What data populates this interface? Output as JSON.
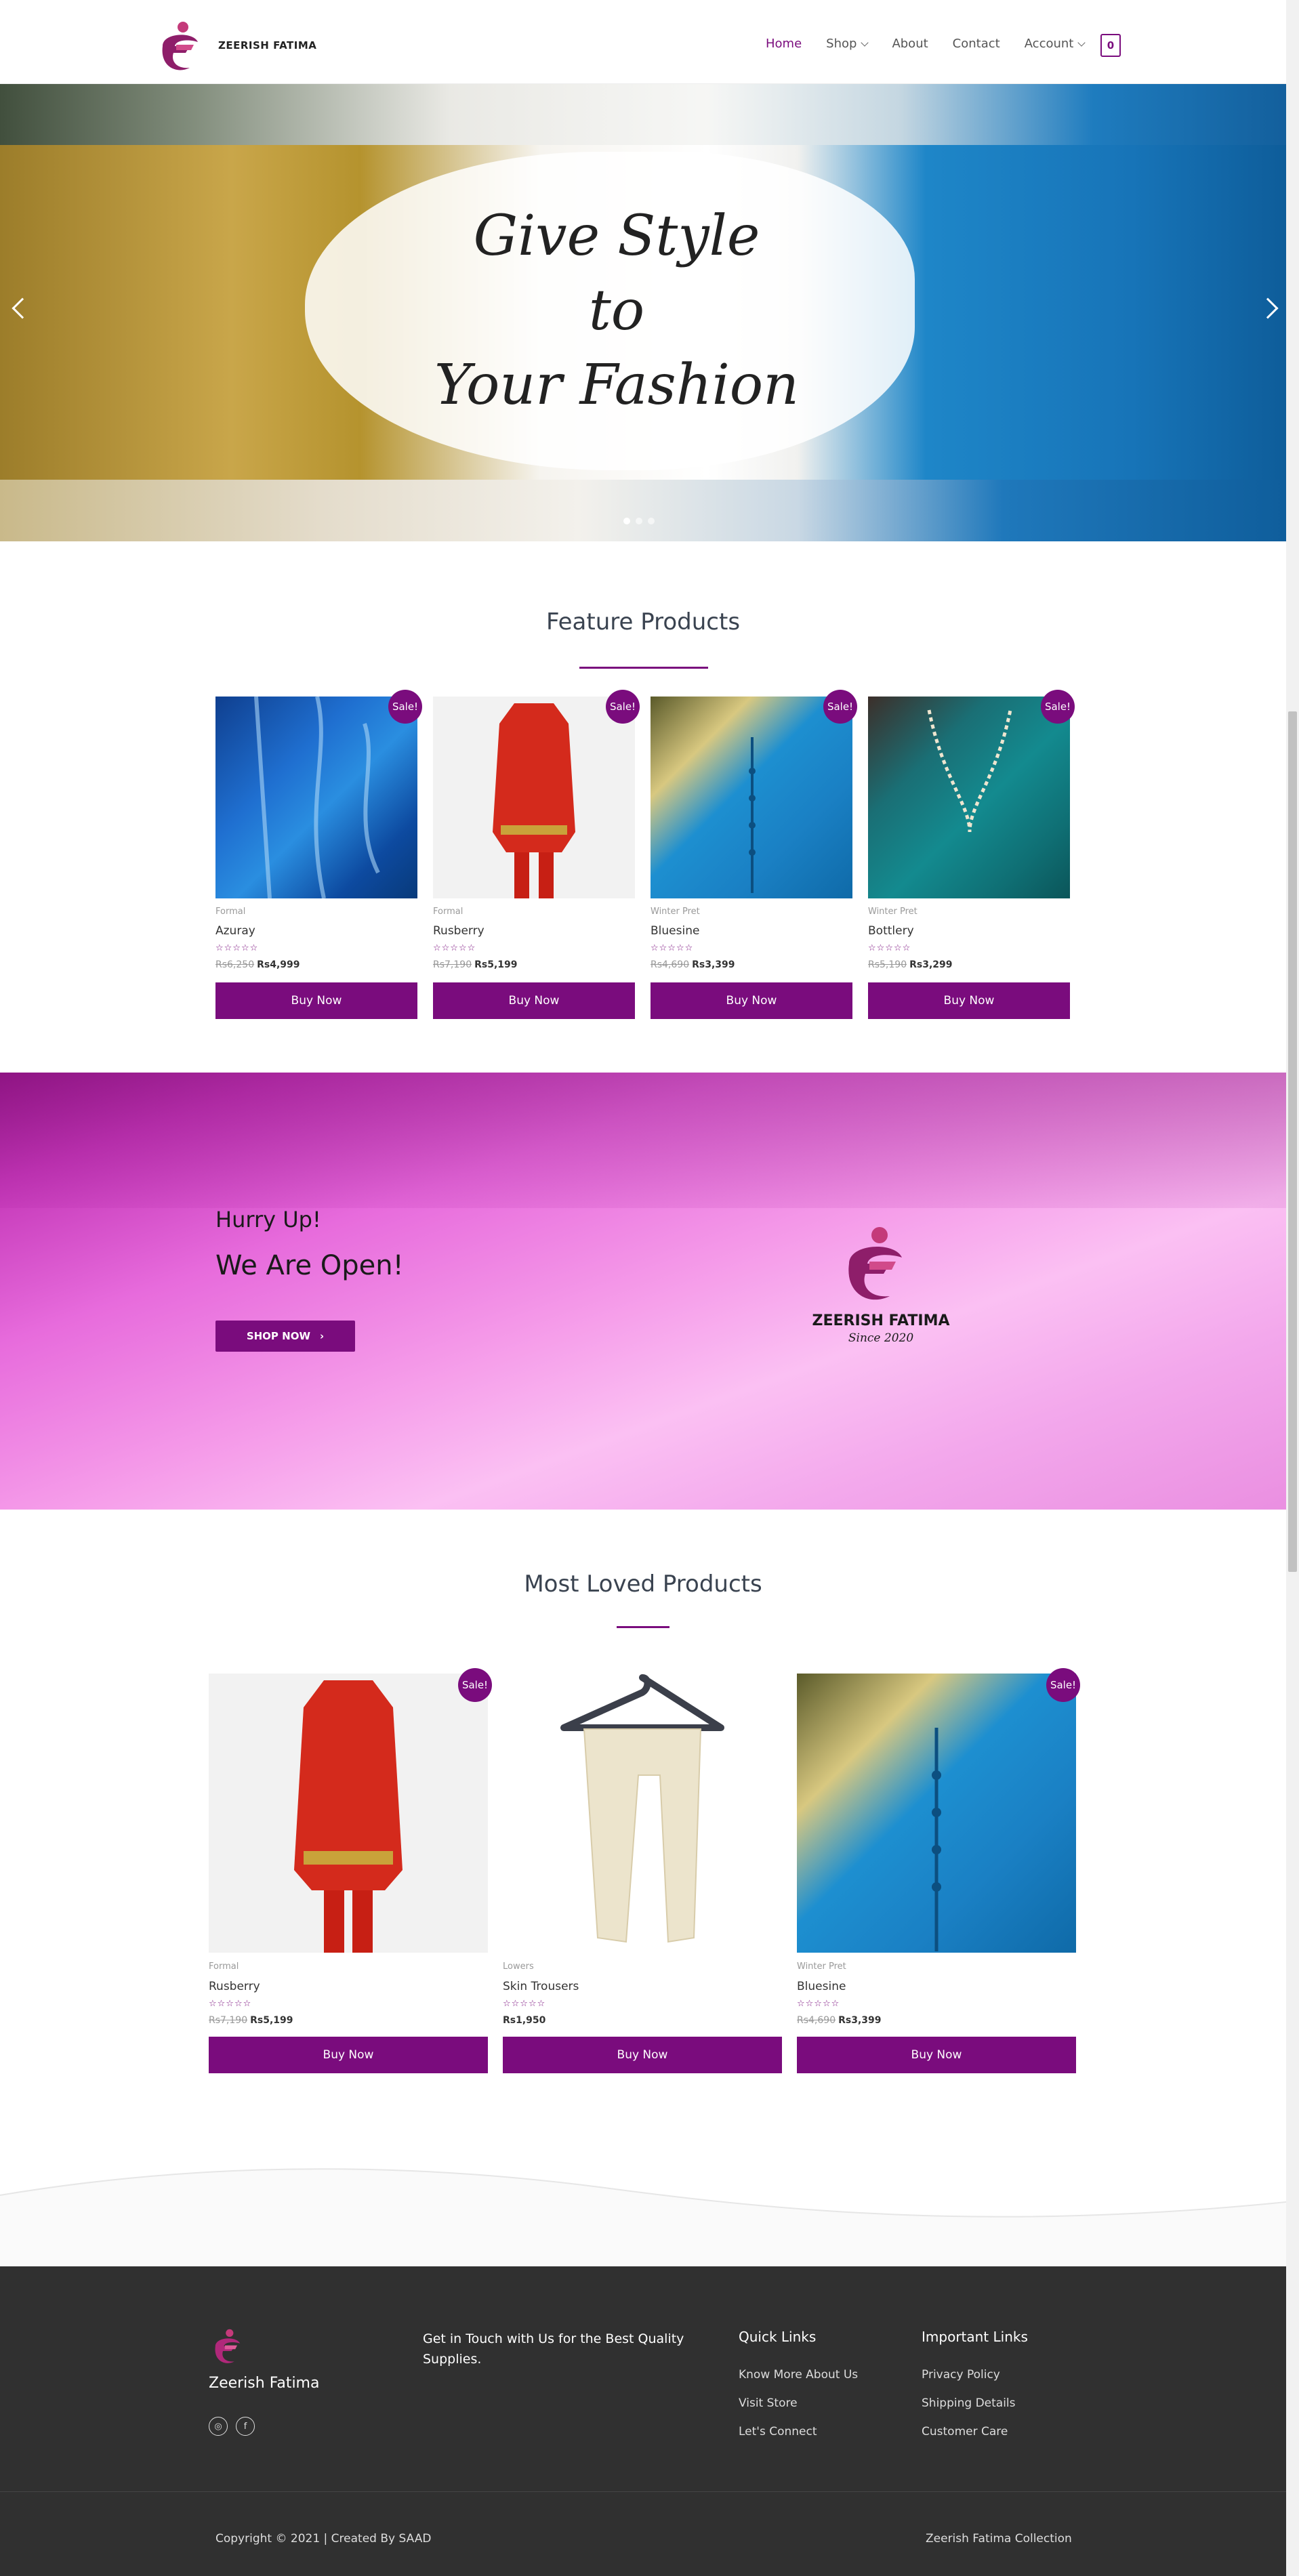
{
  "header": {
    "brand": "ZEERISH FATIMA",
    "nav": [
      {
        "label": "Home",
        "active": true,
        "dropdown": false
      },
      {
        "label": "Shop",
        "active": false,
        "dropdown": true
      },
      {
        "label": "About",
        "active": false,
        "dropdown": false
      },
      {
        "label": "Contact",
        "active": false,
        "dropdown": false
      },
      {
        "label": "Account",
        "active": false,
        "dropdown": true
      }
    ],
    "cart_count": "0"
  },
  "hero": {
    "slogan_lines": [
      "Give Style",
      "to",
      "Your Fashion"
    ],
    "slide_count": 3,
    "active_slide": 1
  },
  "featured": {
    "title": "Feature Products",
    "products": [
      {
        "category": "Formal",
        "name": "Azuray",
        "old_price": "Rs6,250",
        "price": "Rs4,999",
        "sale": "Sale!",
        "button": "Buy Now",
        "rating": 0
      },
      {
        "category": "Formal",
        "name": "Rusberry",
        "old_price": "Rs7,190",
        "price": "Rs5,199",
        "sale": "Sale!",
        "button": "Buy Now",
        "rating": 0
      },
      {
        "category": "Winter Pret",
        "name": "Bluesine",
        "old_price": "Rs4,690",
        "price": "Rs3,399",
        "sale": "Sale!",
        "button": "Buy Now",
        "rating": 0
      },
      {
        "category": "Winter Pret",
        "name": "Bottlery",
        "old_price": "Rs5,190",
        "price": "Rs3,299",
        "sale": "Sale!",
        "button": "Buy Now",
        "rating": 0
      }
    ]
  },
  "promo": {
    "line1": "Hurry Up!",
    "line2": "We Are Open!",
    "button": "SHOP NOW",
    "brand": "ZEERISH FATIMA",
    "since": "Since 2020"
  },
  "loved": {
    "title": "Most Loved Products",
    "products": [
      {
        "category": "Formal",
        "name": "Rusberry",
        "old_price": "Rs7,190",
        "price": "Rs5,199",
        "sale": "Sale!",
        "button": "Buy Now",
        "rating": 0
      },
      {
        "category": "Lowers",
        "name": "Skin Trousers",
        "old_price": "",
        "price": "Rs1,950",
        "sale": "",
        "button": "Buy Now",
        "rating": 0
      },
      {
        "category": "Winter Pret",
        "name": "Bluesine",
        "old_price": "Rs4,690",
        "price": "Rs3,399",
        "sale": "Sale!",
        "button": "Buy Now",
        "rating": 0
      }
    ]
  },
  "footer": {
    "brand": "Zeerish Fatima",
    "touch": "Get in Touch with Us for the Best Quality Supplies.",
    "quick_title": "Quick Links",
    "quick_links": [
      "Know More About Us",
      "Visit Store",
      "Let's Connect"
    ],
    "important_title": "Important Links",
    "important_links": [
      "Privacy Policy",
      "Shipping Details",
      "Customer Care"
    ],
    "copyright": "Copyright © 2021 | Created By SAAD",
    "right_text": "Zeerish Fatima Collection",
    "social_icons": [
      "instagram-icon",
      "facebook-icon"
    ]
  },
  "colors": {
    "accent": "#7a0c7d",
    "footer_bg": "#303030"
  }
}
